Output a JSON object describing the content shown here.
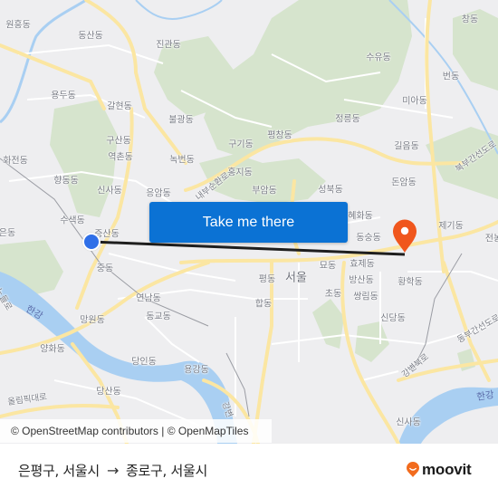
{
  "map": {
    "colors": {
      "land": "#eeeef0",
      "park": "#d4e3cb",
      "water": "#a9cff2",
      "major_road": "#fbe7a4",
      "minor_road": "#ffffff",
      "route_line": "#1e1e1e",
      "origin_marker": "#2f6fe8",
      "destination_marker": "#f0561d"
    },
    "labels": [
      {
        "text": "원흥동",
        "kind": "district"
      },
      {
        "text": "동산동",
        "kind": "district"
      },
      {
        "text": "진관동",
        "kind": "district"
      },
      {
        "text": "용두동",
        "kind": "district"
      },
      {
        "text": "갈현동",
        "kind": "district"
      },
      {
        "text": "불광동",
        "kind": "district"
      },
      {
        "text": "구산동",
        "kind": "district"
      },
      {
        "text": "역촌동",
        "kind": "district"
      },
      {
        "text": "녹번동",
        "kind": "district"
      },
      {
        "text": "구기동",
        "kind": "district"
      },
      {
        "text": "평창동",
        "kind": "district"
      },
      {
        "text": "화전동",
        "kind": "district"
      },
      {
        "text": "향동동",
        "kind": "district"
      },
      {
        "text": "신사동",
        "kind": "district"
      },
      {
        "text": "응암동",
        "kind": "district"
      },
      {
        "text": "홍지동",
        "kind": "district"
      },
      {
        "text": "부암동",
        "kind": "district"
      },
      {
        "text": "성북동",
        "kind": "district"
      },
      {
        "text": "수색동",
        "kind": "district"
      },
      {
        "text": "증산동",
        "kind": "district"
      },
      {
        "text": "은동",
        "kind": "district"
      },
      {
        "text": "중동",
        "kind": "district"
      },
      {
        "text": "창동",
        "kind": "district"
      },
      {
        "text": "수유동",
        "kind": "district"
      },
      {
        "text": "번동",
        "kind": "district"
      },
      {
        "text": "미아동",
        "kind": "district"
      },
      {
        "text": "정릉동",
        "kind": "district"
      },
      {
        "text": "길음동",
        "kind": "district"
      },
      {
        "text": "돈암동",
        "kind": "district"
      },
      {
        "text": "혜화동",
        "kind": "district"
      },
      {
        "text": "제기동",
        "kind": "district"
      },
      {
        "text": "전농",
        "kind": "district"
      },
      {
        "text": "동숭동",
        "kind": "district"
      },
      {
        "text": "묘동",
        "kind": "district"
      },
      {
        "text": "효제동",
        "kind": "district"
      },
      {
        "text": "평동",
        "kind": "district"
      },
      {
        "text": "서울",
        "kind": "city"
      },
      {
        "text": "방산동",
        "kind": "district"
      },
      {
        "text": "황학동",
        "kind": "district"
      },
      {
        "text": "초동",
        "kind": "district"
      },
      {
        "text": "쌍림동",
        "kind": "district"
      },
      {
        "text": "합동",
        "kind": "district"
      },
      {
        "text": "신당동",
        "kind": "district"
      },
      {
        "text": "연남동",
        "kind": "district"
      },
      {
        "text": "망원동",
        "kind": "district"
      },
      {
        "text": "동교동",
        "kind": "district"
      },
      {
        "text": "양화동",
        "kind": "district"
      },
      {
        "text": "당인동",
        "kind": "district"
      },
      {
        "text": "용강동",
        "kind": "district"
      },
      {
        "text": "당산동",
        "kind": "district"
      },
      {
        "text": "신사동",
        "kind": "district"
      },
      {
        "text": "한강",
        "kind": "water"
      },
      {
        "text": "한강",
        "kind": "water"
      },
      {
        "text": "내부순환로",
        "kind": "road"
      },
      {
        "text": "북부간선도로",
        "kind": "road"
      },
      {
        "text": "동부간선도로",
        "kind": "road"
      },
      {
        "text": "강변북로",
        "kind": "road"
      },
      {
        "text": "올림픽대로",
        "kind": "road"
      },
      {
        "text": "강변",
        "kind": "road"
      },
      {
        "text": "노들로",
        "kind": "road"
      }
    ],
    "cta_button": "Take me there",
    "attribution": "© OpenStreetMap contributors | © OpenMapTiles"
  },
  "footer": {
    "origin": "은평구, 서울시",
    "arrow": "→",
    "destination": "종로구, 서울시",
    "brand": "moovit"
  }
}
